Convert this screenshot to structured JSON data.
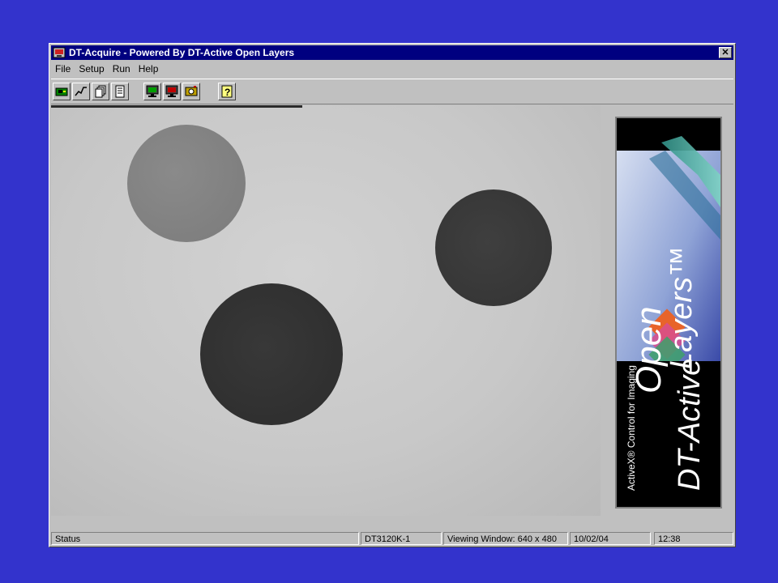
{
  "window": {
    "title": "DT-Acquire - Powered By DT-Active Open Layers",
    "close_label": "✕"
  },
  "menu": [
    "File",
    "Setup",
    "Run",
    "Help"
  ],
  "toolbar": {
    "buttons": [
      "acquire-icon",
      "graph-icon",
      "copy-frames-icon",
      "frame-icon",
      "monitor-green-icon",
      "monitor-red-icon",
      "camera-icon",
      "help-icon"
    ]
  },
  "logo": {
    "tagline": "ActiveX® Control for Imaging",
    "brand": "DT-Active",
    "product_line1": "Open",
    "product_line2": "Layers™"
  },
  "status": {
    "status": "Status",
    "device": "DT3120K-1",
    "viewing_window": "Viewing Window: 640 x 480",
    "date": "10/02/04",
    "time": "12:38"
  },
  "colors": {
    "desktop": "#3333cc",
    "titlebar": "#000080",
    "chrome": "#c0c0c0"
  }
}
